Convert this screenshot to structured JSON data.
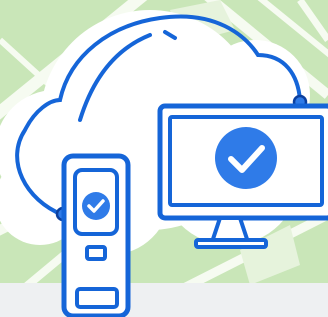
{
  "illustration": {
    "subject": "cloud-sync-devices",
    "icons": [
      "cloud-icon",
      "phone-icon",
      "monitor-icon",
      "checkmark-icon"
    ]
  },
  "colors": {
    "map_background": "#c9e6b8",
    "map_road": "#f6fbf1",
    "map_road_soft": "#e6f3dc",
    "cloud_fill": "#ffffff",
    "stroke_primary": "#1565d8",
    "stroke_dark": "#0b3f9e",
    "badge_fill": "#2f7be8",
    "check_mark": "#ffffff",
    "screen_fill": "#ffffff",
    "footer_band": "#eef0f2"
  }
}
